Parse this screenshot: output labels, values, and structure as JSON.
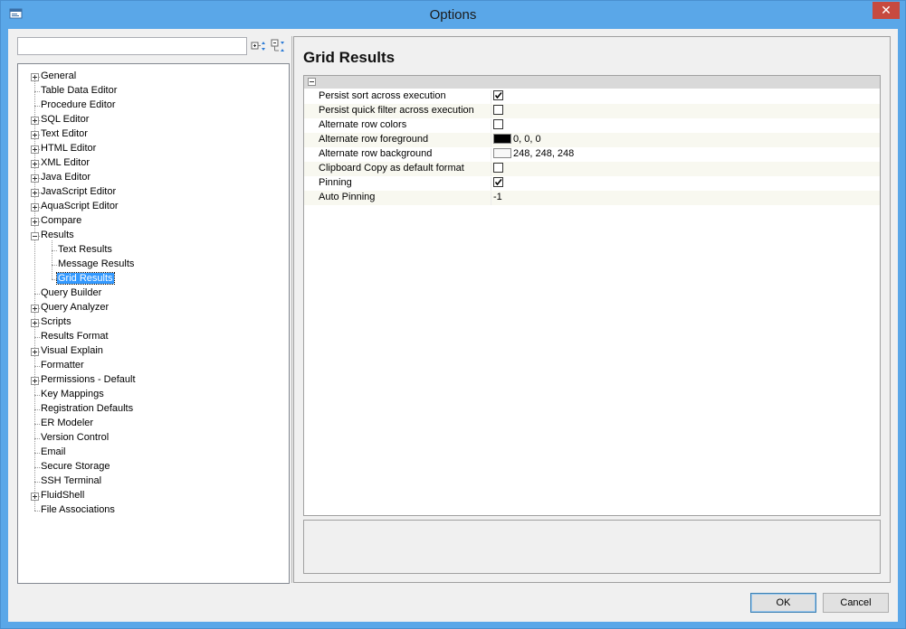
{
  "window": {
    "title": "Options"
  },
  "search": {
    "value": ""
  },
  "tree": {
    "items": [
      {
        "label": "General",
        "indent": 0,
        "expander": "plus"
      },
      {
        "label": "Table Data Editor",
        "indent": 0,
        "expander": ""
      },
      {
        "label": "Procedure Editor",
        "indent": 0,
        "expander": ""
      },
      {
        "label": "SQL Editor",
        "indent": 0,
        "expander": "plus"
      },
      {
        "label": "Text Editor",
        "indent": 0,
        "expander": "plus"
      },
      {
        "label": "HTML Editor",
        "indent": 0,
        "expander": "plus"
      },
      {
        "label": "XML Editor",
        "indent": 0,
        "expander": "plus"
      },
      {
        "label": "Java Editor",
        "indent": 0,
        "expander": "plus"
      },
      {
        "label": "JavaScript Editor",
        "indent": 0,
        "expander": "plus"
      },
      {
        "label": "AquaScript Editor",
        "indent": 0,
        "expander": "plus"
      },
      {
        "label": "Compare",
        "indent": 0,
        "expander": "plus"
      },
      {
        "label": "Results",
        "indent": 0,
        "expander": "minus"
      },
      {
        "label": "Text Results",
        "indent": 1,
        "expander": ""
      },
      {
        "label": "Message Results",
        "indent": 1,
        "expander": ""
      },
      {
        "label": "Grid Results",
        "indent": 1,
        "expander": "",
        "selected": true
      },
      {
        "label": "Query Builder",
        "indent": 0,
        "expander": ""
      },
      {
        "label": "Query Analyzer",
        "indent": 0,
        "expander": "plus"
      },
      {
        "label": "Scripts",
        "indent": 0,
        "expander": "plus"
      },
      {
        "label": "Results Format",
        "indent": 0,
        "expander": ""
      },
      {
        "label": "Visual Explain",
        "indent": 0,
        "expander": "plus"
      },
      {
        "label": "Formatter",
        "indent": 0,
        "expander": ""
      },
      {
        "label": "Permissions - Default",
        "indent": 0,
        "expander": "plus"
      },
      {
        "label": "Key Mappings",
        "indent": 0,
        "expander": ""
      },
      {
        "label": "Registration Defaults",
        "indent": 0,
        "expander": ""
      },
      {
        "label": "ER Modeler",
        "indent": 0,
        "expander": ""
      },
      {
        "label": "Version Control",
        "indent": 0,
        "expander": ""
      },
      {
        "label": "Email",
        "indent": 0,
        "expander": ""
      },
      {
        "label": "Secure Storage",
        "indent": 0,
        "expander": ""
      },
      {
        "label": "SSH Terminal",
        "indent": 0,
        "expander": ""
      },
      {
        "label": "FluidShell",
        "indent": 0,
        "expander": "plus"
      },
      {
        "label": "File Associations",
        "indent": 0,
        "expander": ""
      }
    ]
  },
  "page": {
    "title": "Grid Results"
  },
  "properties": [
    {
      "name": "Persist sort across execution",
      "type": "checkbox",
      "checked": true
    },
    {
      "name": "Persist quick filter across execution",
      "type": "checkbox",
      "checked": false
    },
    {
      "name": "Alternate row colors",
      "type": "checkbox",
      "checked": false
    },
    {
      "name": "Alternate row foreground",
      "type": "color",
      "color": "#000000",
      "value": "0, 0, 0"
    },
    {
      "name": "Alternate row background",
      "type": "color",
      "color": "#f8f8f8",
      "value": "248, 248, 248"
    },
    {
      "name": "Clipboard Copy as default format",
      "type": "checkbox",
      "checked": false
    },
    {
      "name": "Pinning",
      "type": "checkbox",
      "checked": true
    },
    {
      "name": "Auto Pinning",
      "type": "text",
      "value": "-1"
    }
  ],
  "buttons": {
    "ok": "OK",
    "cancel": "Cancel"
  },
  "colors": {
    "titlebar": "#5aa7e8",
    "close": "#c74a3f",
    "selection": "#3399ff"
  }
}
